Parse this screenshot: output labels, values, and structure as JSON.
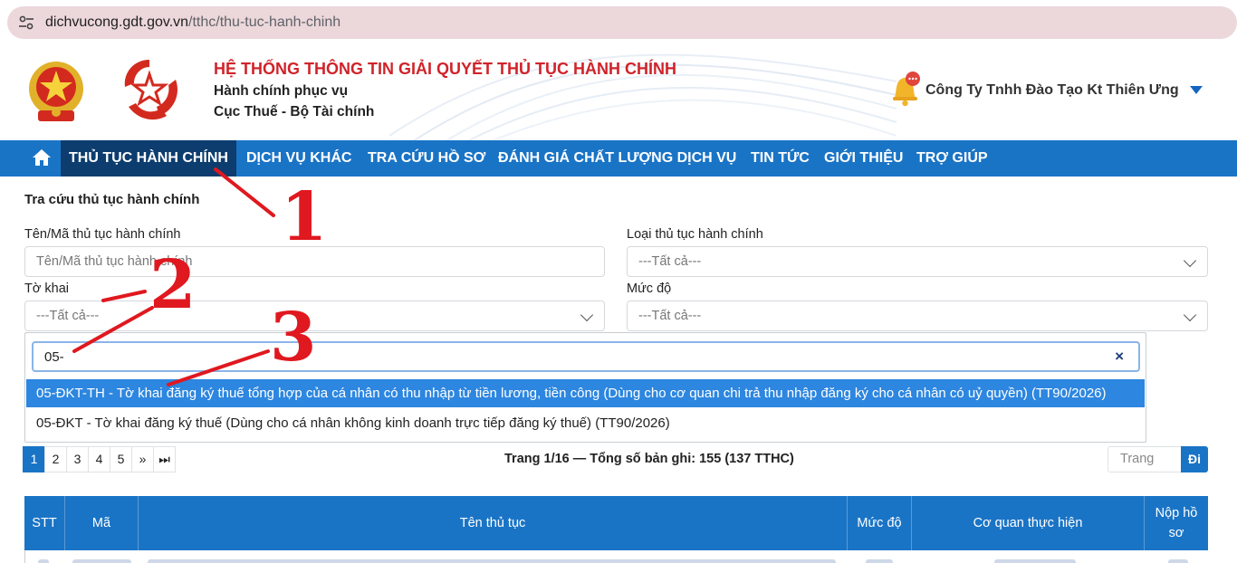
{
  "browser": {
    "url_domain": "dichvucong.gdt.gov.vn",
    "url_path": "/tthc/thu-tuc-hanh-chinh"
  },
  "header": {
    "title": "HỆ THỐNG THÔNG TIN GIẢI QUYẾT THỦ TỤC HÀNH CHÍNH",
    "subtitle1": "Hành chính phục vụ",
    "subtitle2": "Cục Thuế - Bộ Tài chính",
    "user_name": "Công Ty Tnhh Đào Tạo Kt Thiên Ưng",
    "brand_red": "#d0232a"
  },
  "nav": {
    "items": [
      "THỦ TỤC HÀNH CHÍNH",
      "DỊCH VỤ KHÁC",
      "TRA CỨU HỒ SƠ",
      "ĐÁNH GIÁ CHẤT LƯỢNG DỊCH VỤ",
      "TIN TỨC",
      "GIỚI THIỆU",
      "TRỢ GIÚP"
    ],
    "active_index": 0,
    "bg_color": "#1a74c6",
    "active_color": "#0c3d6e"
  },
  "search": {
    "section_title": "Tra cứu thủ tục hành chính",
    "name_label": "Tên/Mã thủ tục hành chính",
    "name_placeholder": "Tên/Mã thủ tục hành chính",
    "type_label": "Loại thủ tục hành chính",
    "type_value": "---Tất cả---",
    "form_label": "Tờ khai",
    "form_value": "---Tất cả---",
    "level_label": "Mức độ",
    "level_value": "---Tất cả---"
  },
  "dropdown": {
    "query": "05-",
    "clear_symbol": "×",
    "options": [
      "05-ĐKT-TH - Tờ khai đăng ký thuế tổng hợp của cá nhân có thu nhập từ tiền lương, tiền công (Dùng cho cơ quan chi trả thu nhập đăng ký cho cá nhân có uỷ quyền) (TT90/2026)",
      "05-ĐKT - Tờ khai đăng ký thuế (Dùng cho cá nhân không kinh doanh trực tiếp đăng ký thuế) (TT90/2026)"
    ],
    "selected_index": 0
  },
  "pagination": {
    "pages": [
      "1",
      "2",
      "3",
      "4",
      "5",
      "»",
      "⏭"
    ],
    "current": "1",
    "info": "Trang 1/16 — Tổng số bản ghi: 155 (137 TTHC)",
    "goto_placeholder": "Trang",
    "goto_button": "Đi"
  },
  "table": {
    "headers": [
      "STT",
      "Mã",
      "Tên thủ tục",
      "Mức độ",
      "Cơ quan thực hiện",
      "Nộp hồ sơ"
    ]
  },
  "annotations": {
    "markers": [
      "1",
      "2",
      "3"
    ],
    "color": "#e0181f"
  }
}
